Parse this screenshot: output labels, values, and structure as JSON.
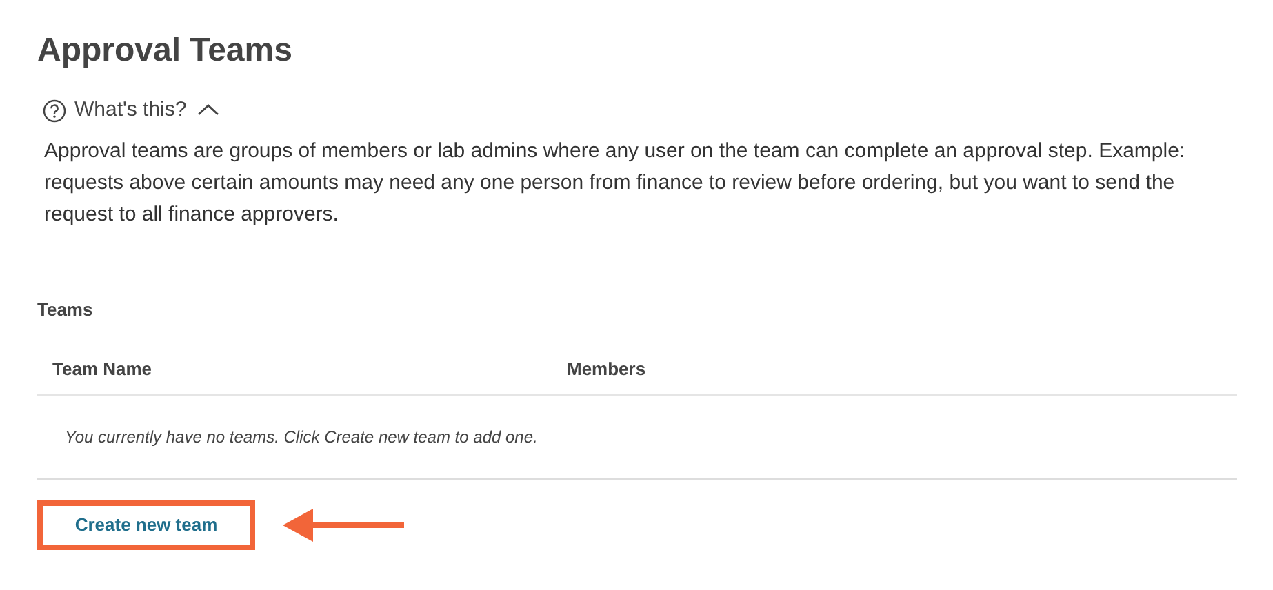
{
  "title": "Approval Teams",
  "help": {
    "label": "What's this?",
    "expanded": true,
    "text": "Approval teams are groups of members or lab admins where any user on the team can complete an approval step. Example: requests above certain amounts may need any one person from finance to review before ordering, but you want to send the request to all finance approvers."
  },
  "teams": {
    "heading": "Teams",
    "columns": [
      "Team Name",
      "Members"
    ],
    "empty_message": "You currently have no teams. Click Create new team to add one."
  },
  "create_button": {
    "label": "Create new team",
    "highlighted": true
  }
}
